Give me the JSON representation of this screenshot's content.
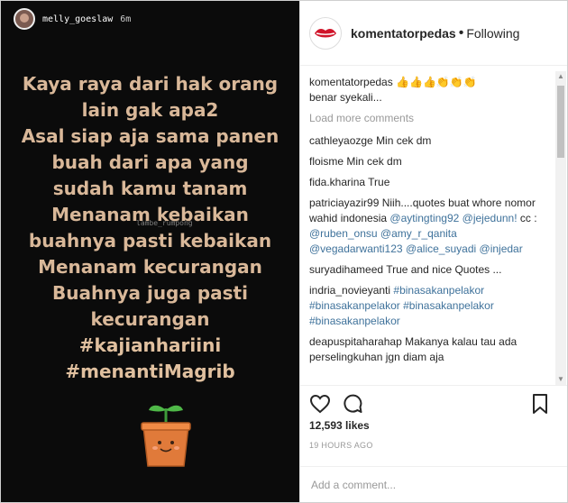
{
  "story": {
    "username": "melly_goeslaw",
    "time": "6m",
    "lines": [
      "Kaya raya dari hak orang",
      "lain gak apa2",
      "Asal siap aja sama panen",
      "buah dari apa yang",
      "sudah kamu tanam",
      "Menanam kebaikan",
      "buahnya pasti kebaikan",
      "Menanam kecurangan",
      "Buahnya juga pasti",
      "kecurangan",
      "#kajianhariini",
      "#menantiMagrib"
    ],
    "watermark": "lambe_rumpong"
  },
  "post": {
    "username": "komentatorpedas",
    "separator": "•",
    "follow_status": "Following",
    "caption_user": "komentatorpedas",
    "caption_text": "👍👍👍👏👏👏",
    "caption_text2": "benar syekali...",
    "load_more": "Load more comments",
    "comments": [
      {
        "user": "cathleyaozge",
        "text": "Min cek dm"
      },
      {
        "user": "floisme",
        "text": "Min cek dm"
      },
      {
        "user": "fida.kharina",
        "text": "True"
      },
      {
        "user": "patriciayazir99",
        "text": "Niih....quotes buat whore nomor wahid indonesia",
        "tags": [
          "@aytingting92",
          "@jejedunn!",
          "cc :",
          "@ruben_onsu",
          "@amy_r_qanita",
          "@vegadarwanti123",
          "@alice_suyadi",
          "@injedar"
        ]
      },
      {
        "user": "suryadihameed",
        "text": "True and nice Quotes ..."
      },
      {
        "user": "indria_novieyanti",
        "text": "",
        "tags": [
          "#binasakanpelakor",
          "#binasakanpelakor",
          "#binasakanpelakor",
          "#binasakanpelakor"
        ]
      },
      {
        "user": "deapuspitaharahap",
        "text": "Makanya kalau tau ada perselingkuhan jgn diam aja"
      }
    ],
    "likes": "12,593 likes",
    "timestamp": "19 HOURS AGO",
    "add_comment_placeholder": "Add a comment..."
  },
  "icons": [
    "heart-icon",
    "comment-icon",
    "bookmark-icon",
    "lips-logo-icon",
    "plant-pot-icon"
  ]
}
